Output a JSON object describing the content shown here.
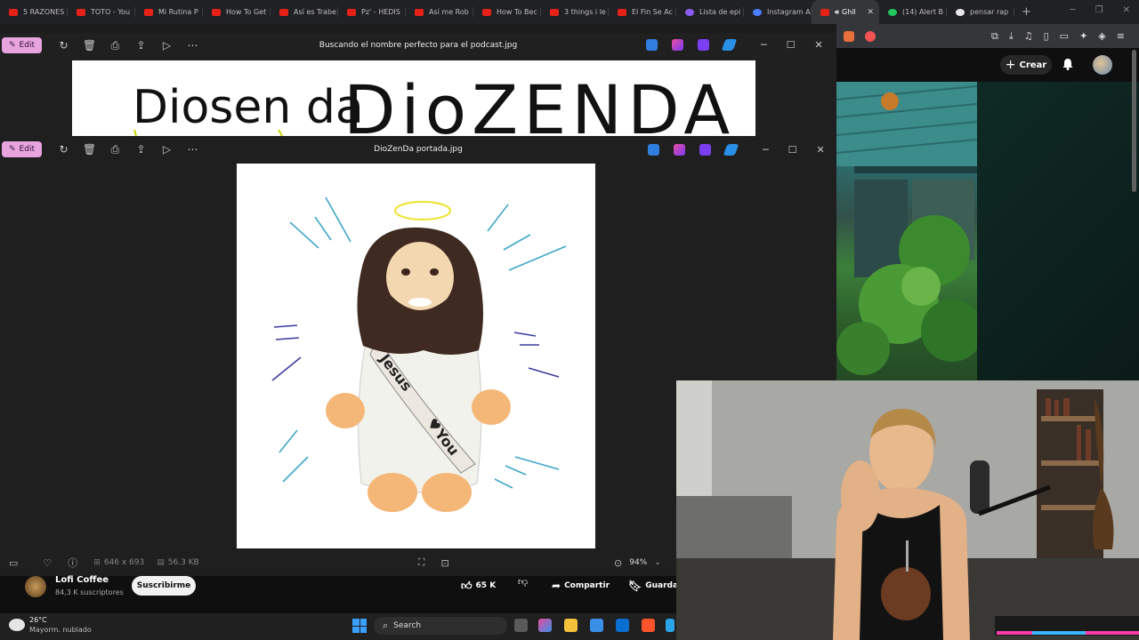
{
  "browser": {
    "tabs": [
      {
        "label": "5 RAZONES",
        "icon": "youtube-icon"
      },
      {
        "label": "TOTO - You",
        "icon": "youtube-icon"
      },
      {
        "label": "Mi Rutina P",
        "icon": "youtube-icon"
      },
      {
        "label": "How To Get",
        "icon": "youtube-icon"
      },
      {
        "label": "Así es Trabe",
        "icon": "youtube-icon"
      },
      {
        "label": "Pz' - HEDIS",
        "icon": "youtube-icon"
      },
      {
        "label": "Así me Rob",
        "icon": "youtube-icon"
      },
      {
        "label": "How To Bec",
        "icon": "youtube-icon"
      },
      {
        "label": "3 things i le",
        "icon": "youtube-icon"
      },
      {
        "label": "El Fin Se Ac",
        "icon": "youtube-icon"
      },
      {
        "label": "Lista de epi",
        "icon": "purple-icon"
      },
      {
        "label": "Instagram A",
        "icon": "blue-icon"
      },
      {
        "label": "Ghil",
        "icon": "youtube-icon",
        "active": true
      },
      {
        "label": "(14) Alert B",
        "icon": "green-icon"
      },
      {
        "label": "pensar rap",
        "icon": "google-icon"
      }
    ],
    "new_tab": "+"
  },
  "youtube": {
    "create_label": "Crear",
    "channel_name": "Lofi Coffee",
    "subscribers": "84,3 K suscriptores",
    "subscribe_label": "Suscribirme",
    "likes": "65 K",
    "share_label": "Compartir",
    "save_label": "Guardar"
  },
  "photos_back": {
    "edit_label": "Edit",
    "title": "Buscando el nombre perfecto para el podcast.jpg",
    "handwriting_left": "Diosen da",
    "handwriting_right": "DioZENDA"
  },
  "photos_front": {
    "edit_label": "Edit",
    "title": "DioZenDa portada.jpg",
    "dimensions": "646 x 693",
    "filesize": "56.3 KB",
    "zoom": "94%",
    "sash_text_1": "Jesus",
    "sash_text_2": "You"
  },
  "taskbar": {
    "temperature": "26°C",
    "weather": "Mayorm. nublado",
    "search_label": "Search"
  },
  "colors": {
    "edit_pink": "#e8a4df",
    "youtube_red": "#e62117",
    "accent_blue": "#3aa0ff"
  }
}
